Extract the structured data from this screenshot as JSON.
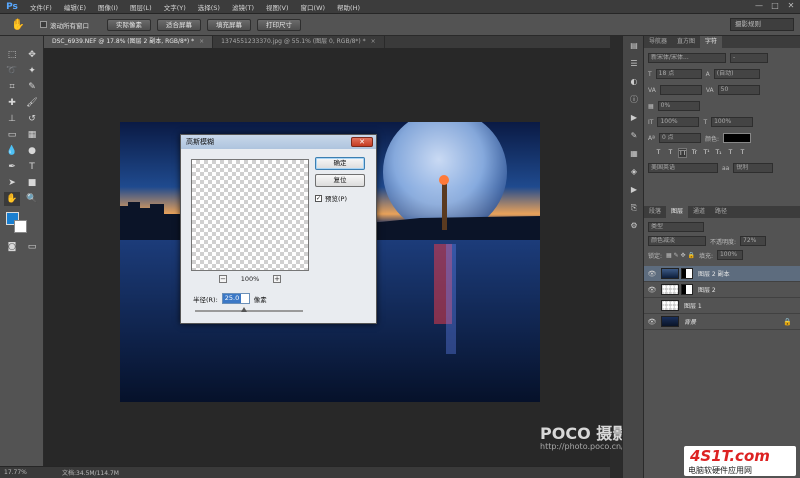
{
  "menubar": {
    "logo": "Ps",
    "items": [
      "文件(F)",
      "编辑(E)",
      "图像(I)",
      "图层(L)",
      "文字(Y)",
      "选择(S)",
      "滤镜(T)",
      "视图(V)",
      "窗口(W)",
      "帮助(H)"
    ],
    "controls": [
      "—",
      "□",
      "✕"
    ]
  },
  "options_bar": {
    "tool_icon": "hand-icon",
    "scroll_all_label": "滚动所有窗口",
    "buttons": [
      "实际像素",
      "适合屏幕",
      "填充屏幕",
      "打印尺寸"
    ],
    "workspace": "摄影规则"
  },
  "tabs": [
    {
      "label": "DSC_6939.NEF @ 17.8% (图层 2 副本, RGB/8*) *",
      "close": "×",
      "active": true
    },
    {
      "label": "1374551233370.jpg @ 55.1% (图层 0, RGB/8*) *",
      "close": "×",
      "active": false
    }
  ],
  "status": {
    "zoom": "17.77%",
    "doc_info": "文档:34.5M/114.7M"
  },
  "dialog": {
    "title": "高斯模糊",
    "close_label": "✕",
    "ok_label": "确定",
    "reset_label": "复位",
    "preview_label": "预览(P)",
    "preview_checked": "✓",
    "zoom_minus": "−",
    "zoom_plus": "+",
    "zoom_value": "100%",
    "radius_label": "半径(R):",
    "radius_value": "25.0",
    "radius_unit": "像素"
  },
  "watermark": {
    "brand": "POCO 摄影专题",
    "url": "http://photo.poco.cn/"
  },
  "badge": {
    "logo": "4S1T.com",
    "text": "电脑软硬件应用网"
  },
  "panels": {
    "top_tabs": [
      "导航器",
      "直方图",
      "字符"
    ],
    "font_family": "新宋体/宋体...",
    "font_style": "-",
    "font_size": "18 点",
    "leading": "(自动)",
    "kerning": "",
    "tracking": "50",
    "vscale_pct": "0%",
    "scale_h": "100%",
    "scale_v": "100%",
    "baseline": "0 点",
    "color_label": "颜色:",
    "format_buttons": [
      "T",
      "T",
      "TT",
      "Tr",
      "T¹",
      "T₁",
      "T",
      "T"
    ],
    "language": "美国英语",
    "aa_label": "aa",
    "aa_mode": "锐利"
  },
  "layers_panel": {
    "tabs": [
      "段落",
      "图层",
      "通道",
      "路径"
    ],
    "filter_kind": "类型",
    "blend_mode": "颜色减淡",
    "opacity_label": "不透明度:",
    "opacity": "72%",
    "lock_label": "锁定:",
    "fill_label": "填充:",
    "fill": "100%",
    "layers": [
      {
        "name": "图层 2 副本",
        "visible": "👁",
        "thumb": "blur",
        "mask": true,
        "selected": true,
        "italic": false,
        "lock": ""
      },
      {
        "name": "图层 2",
        "visible": "👁",
        "thumb": "trans",
        "mask": true,
        "selected": false,
        "italic": false,
        "lock": ""
      },
      {
        "name": "图层 1",
        "visible": "",
        "thumb": "trans",
        "mask": false,
        "selected": false,
        "italic": false,
        "lock": ""
      },
      {
        "name": "背景",
        "visible": "👁",
        "thumb": "bg",
        "mask": false,
        "selected": false,
        "italic": true,
        "lock": "🔒"
      }
    ]
  }
}
